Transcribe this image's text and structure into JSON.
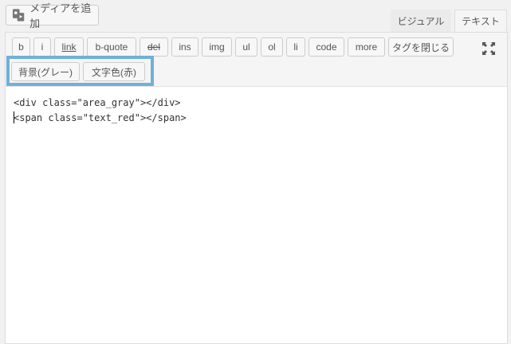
{
  "media_button": {
    "label": "メディアを追加",
    "icon": "media-add-icon"
  },
  "tabs": {
    "visual": "ビジュアル",
    "text": "テキスト"
  },
  "quicktags": [
    "b",
    "i",
    "link",
    "b-quote",
    "del",
    "ins",
    "img",
    "ul",
    "ol",
    "li",
    "code",
    "more",
    "タグを閉じる"
  ],
  "custom_buttons": [
    "背景(グレー)",
    "文字色(赤)"
  ],
  "fullscreen_icon": "fullscreen-icon",
  "highlight_color": "#6fb1d8",
  "content_lines": [
    "<div class=\"area_gray\"></div>",
    "<span class=\"text_red\"></span>"
  ]
}
